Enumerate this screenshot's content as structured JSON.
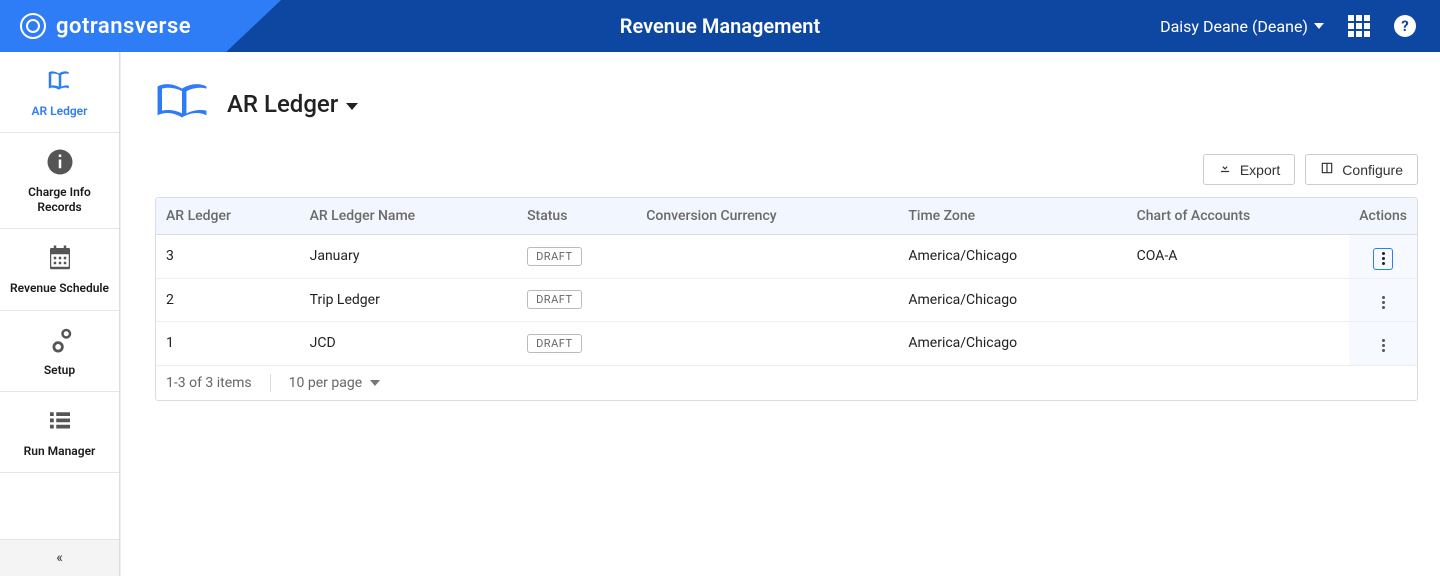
{
  "header": {
    "brand": "gotransverse",
    "title": "Revenue Management",
    "user_display": "Daisy Deane (Deane)"
  },
  "sidebar": {
    "items": [
      {
        "label": "AR Ledger"
      },
      {
        "label": "Charge Info Records"
      },
      {
        "label": "Revenue Schedule"
      },
      {
        "label": "Setup"
      },
      {
        "label": "Run Manager"
      }
    ]
  },
  "page": {
    "title": "AR Ledger"
  },
  "toolbar": {
    "export_label": "Export",
    "configure_label": "Configure"
  },
  "table": {
    "headers": {
      "ar_ledger": "AR Ledger",
      "name": "AR Ledger Name",
      "status": "Status",
      "conversion_currency": "Conversion Currency",
      "time_zone": "Time Zone",
      "chart_of_accounts": "Chart of Accounts",
      "actions": "Actions"
    },
    "rows": [
      {
        "ar_ledger": "3",
        "name": "January",
        "status": "DRAFT",
        "conversion_currency": "",
        "time_zone": "America/Chicago",
        "chart_of_accounts": "COA-A"
      },
      {
        "ar_ledger": "2",
        "name": "Trip Ledger",
        "status": "DRAFT",
        "conversion_currency": "",
        "time_zone": "America/Chicago",
        "chart_of_accounts": ""
      },
      {
        "ar_ledger": "1",
        "name": "JCD",
        "status": "DRAFT",
        "conversion_currency": "",
        "time_zone": "America/Chicago",
        "chart_of_accounts": ""
      }
    ],
    "footer": {
      "range_text": "1-3 of 3 items",
      "per_page_text": "10 per page"
    }
  }
}
